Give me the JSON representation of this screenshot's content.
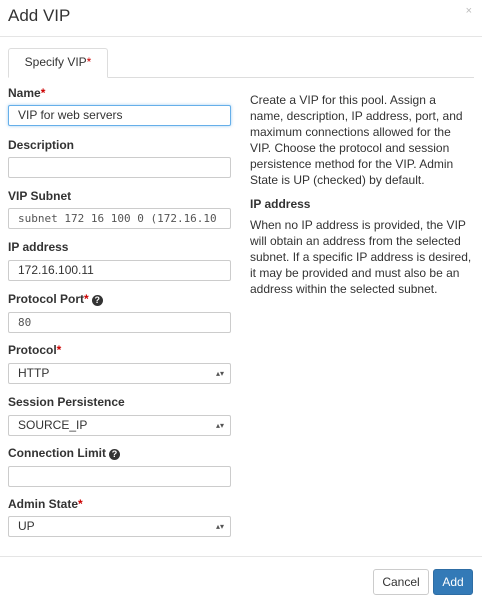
{
  "modal": {
    "title": "Add VIP",
    "close": "×"
  },
  "tabs": [
    {
      "label": "Specify VIP",
      "required": "*"
    }
  ],
  "form": {
    "name": {
      "label": "Name",
      "required": "*",
      "value": "VIP for web servers"
    },
    "description": {
      "label": "Description",
      "value": ""
    },
    "vip_subnet": {
      "label": "VIP Subnet",
      "value": "subnet 172 16 100 0 (172.16.10"
    },
    "ip_address": {
      "label": "IP address",
      "value": "172.16.100.11"
    },
    "protocol_port": {
      "label": "Protocol Port",
      "required": "*",
      "help": "?",
      "value": "80"
    },
    "protocol": {
      "label": "Protocol",
      "required": "*",
      "value": "HTTP"
    },
    "session_persistence": {
      "label": "Session Persistence",
      "value": "SOURCE_IP"
    },
    "connection_limit": {
      "label": "Connection Limit",
      "help": "?",
      "value": ""
    },
    "admin_state": {
      "label": "Admin State",
      "required": "*",
      "value": "UP"
    }
  },
  "help_text": {
    "intro": "Create a VIP for this pool. Assign a name, description, IP address, port, and maximum connections allowed for the VIP. Choose the protocol and session persistence method for the VIP. Admin State is UP (checked) by default.",
    "ip_heading": "IP address",
    "ip_body": "When no IP address is provided, the VIP will obtain an address from the selected subnet. If a specific IP address is desired, it may be provided and must also be an address within the selected subnet."
  },
  "footer": {
    "cancel": "Cancel",
    "add": "Add"
  },
  "icons": {
    "select_caret": "▴▾"
  }
}
